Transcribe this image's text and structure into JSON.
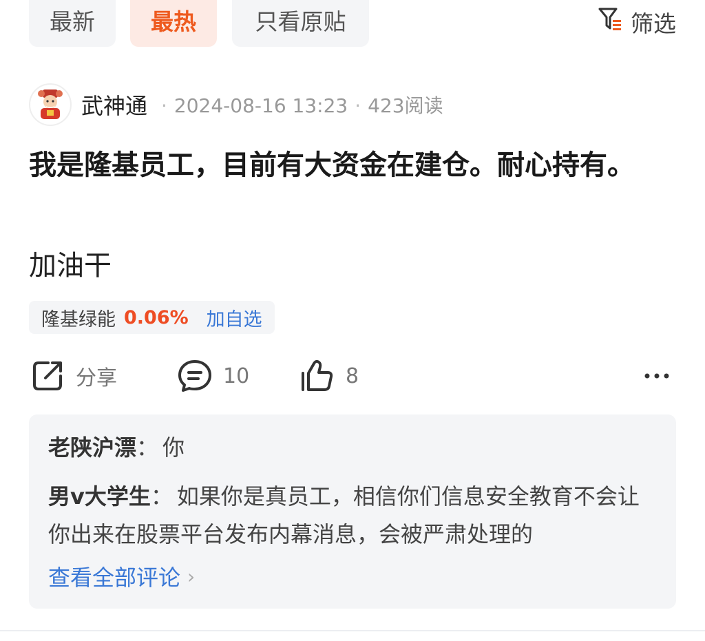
{
  "tabs": {
    "latest": "最新",
    "hot": "最热",
    "original_only": "只看原贴",
    "filter_label": "筛选",
    "active_color": "#ee5a1e"
  },
  "post": {
    "author": "武神通",
    "date": "2024-08-16 13:23",
    "reads": "423阅读",
    "title": "我是隆基员工，目前有大资金在建仓。耐心持有。",
    "body": "加油干",
    "stock": {
      "name": "隆基绿能",
      "change": "0.06%",
      "add_label": "加自选",
      "change_color": "#ee4d24"
    },
    "actions": {
      "share_label": "分享",
      "comment_count": "10",
      "like_count": "8"
    }
  },
  "comments": [
    {
      "user": "老陕沪漂",
      "text": "你"
    },
    {
      "user": "男v大学生",
      "text": "如果你是真员工，相信你们信息安全教育不会让你出来在股票平台发布内幕消息，会被严肃处理的"
    }
  ],
  "view_all_label": "查看全部评论",
  "icons": [
    "filter-icon",
    "avatar-icon",
    "share-icon",
    "comment-icon",
    "like-icon",
    "more-icon",
    "chevron-right-icon"
  ]
}
